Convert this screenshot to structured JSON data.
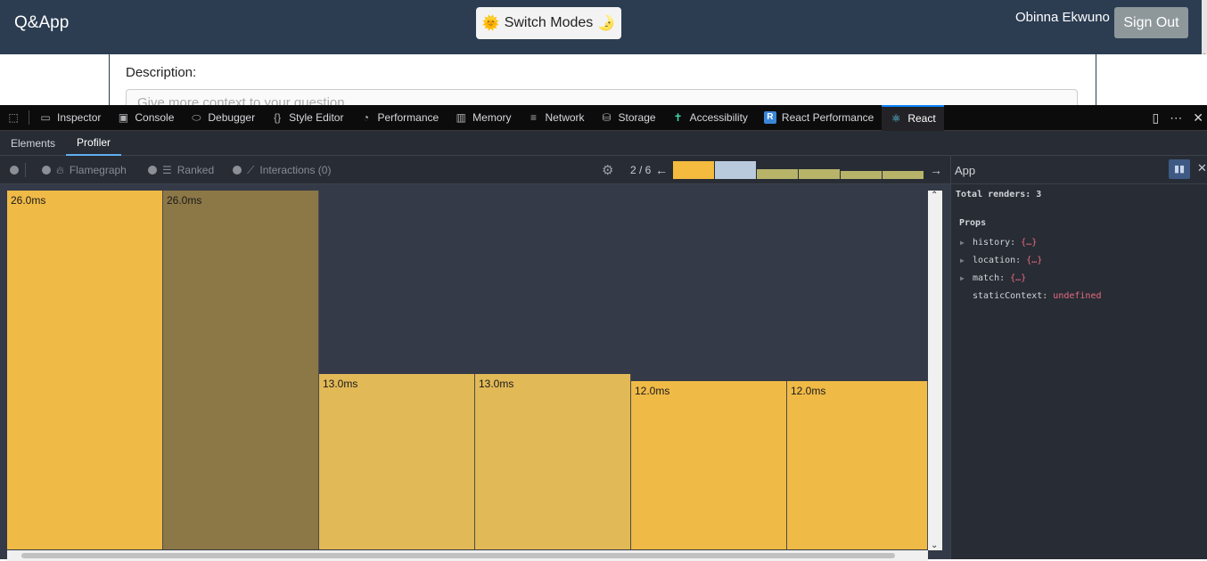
{
  "app": {
    "title": "Q&App",
    "switch_label": "Switch Modes",
    "user_name": "Obinna Ekwuno",
    "signout_label": "Sign Out"
  },
  "form": {
    "description_label": "Description:",
    "description_placeholder": "Give more context to your question"
  },
  "devtools": {
    "tabs": [
      "Inspector",
      "Console",
      "Debugger",
      "Style Editor",
      "Performance",
      "Memory",
      "Network",
      "Storage",
      "Accessibility",
      "React Performance",
      "React"
    ],
    "selected_tab": "React",
    "react_badge": "R"
  },
  "react_devtools": {
    "tabs": [
      "Elements",
      "Profiler"
    ],
    "active_tab": "Profiler",
    "modes": {
      "flamegraph": "Flamegraph",
      "ranked": "Ranked",
      "interactions": "Interactions (0)"
    },
    "commit_counter": "2 / 6",
    "commits": [
      {
        "color": "#f4bb3e",
        "level": 1.0
      },
      {
        "color": "#b8cadc",
        "level": 1.0
      },
      {
        "color": "#b7b46a",
        "level": 0.55
      },
      {
        "color": "#b7b46a",
        "level": 0.55
      },
      {
        "color": "#b7b46a",
        "level": 0.45
      },
      {
        "color": "#b7b46a",
        "level": 0.45
      }
    ]
  },
  "flamegraph": {
    "bars": [
      {
        "label": "26.0ms",
        "value": 26.0,
        "color": "#f0ba47"
      },
      {
        "label": "26.0ms",
        "value": 26.0,
        "color": "#8c7746"
      },
      {
        "label": "13.0ms",
        "value": 13.0,
        "color": "#e2b957"
      },
      {
        "label": "13.0ms",
        "value": 13.0,
        "color": "#e2b957"
      },
      {
        "label": "12.0ms",
        "value": 12.0,
        "color": "#f0ba47"
      },
      {
        "label": "12.0ms",
        "value": 12.0,
        "color": "#f0ba47"
      }
    ]
  },
  "sidebar": {
    "component_name": "App",
    "total_renders": "Total renders: 3",
    "props_heading": "Props",
    "props": [
      {
        "key": "history:",
        "value": "{…}",
        "expandable": true
      },
      {
        "key": "location:",
        "value": "{…}",
        "expandable": true
      },
      {
        "key": "match:",
        "value": "{…}",
        "expandable": true
      },
      {
        "key": "staticContext:",
        "value": "undefined",
        "expandable": false
      }
    ]
  }
}
